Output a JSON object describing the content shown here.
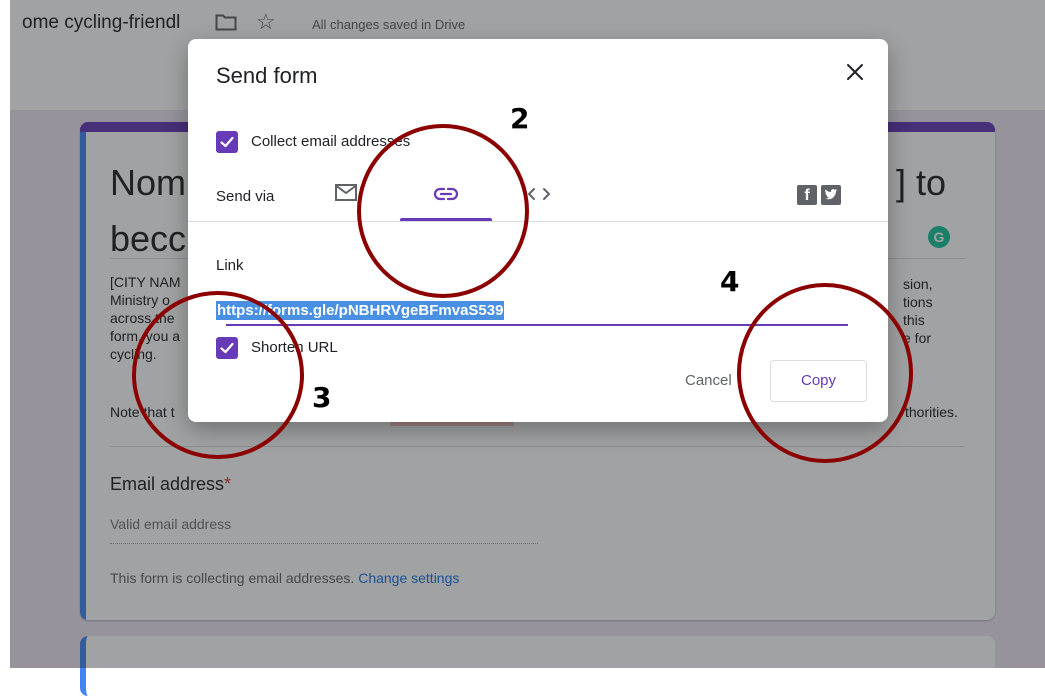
{
  "topbar": {
    "doc_title": "ome cycling-friendl",
    "saved_status": "All changes saved in Drive"
  },
  "form": {
    "title_line1": "Nom",
    "title_line2": "becc",
    "title_right": "] to",
    "grammarly_badge": "G",
    "description_left": [
      "[CITY NAM",
      "Ministry o",
      "across the",
      "form, you a",
      "cycling."
    ],
    "description_right": [
      "sion,",
      "tions",
      "this",
      "e for"
    ],
    "note_left": "Note that t",
    "note_right": "thorities.",
    "email_question": "Email address",
    "email_required_mark": "*",
    "email_placeholder": "Valid email address",
    "collecting_notice": "This form is collecting email addresses.",
    "change_settings_link": "Change settings"
  },
  "dialog": {
    "title": "Send form",
    "collect_email_label": "Collect email addresses",
    "collect_email_checked": true,
    "send_via_label": "Send via",
    "tabs": [
      {
        "name": "email",
        "icon": "mail-icon"
      },
      {
        "name": "link",
        "icon": "link-icon",
        "selected": true
      },
      {
        "name": "embed",
        "icon": "embed-code-icon"
      }
    ],
    "social": [
      "facebook-icon",
      "twitter-icon"
    ],
    "link_heading": "Link",
    "link_url": "https://forms.gle/pNBHRVgeBFmvaS539",
    "shorten_url_label": "Shorten URL",
    "shorten_url_checked": true,
    "cancel_label": "Cancel",
    "copy_label": "Copy"
  },
  "annotations": {
    "step_2": "2",
    "step_3": "3",
    "step_4": "4",
    "circle_color": "#8b0000"
  },
  "colors": {
    "accent": "#673ab7",
    "link_blue": "#1a73e8",
    "selection_highlight": "#4a90e2"
  }
}
